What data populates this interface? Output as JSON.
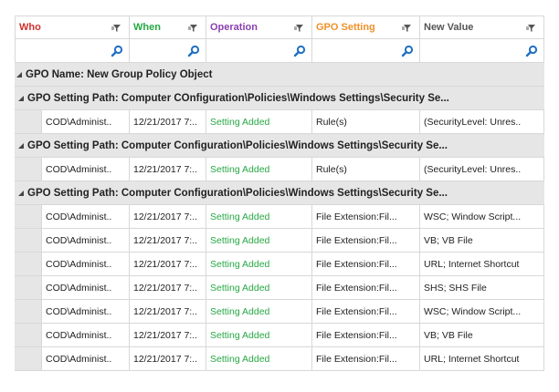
{
  "columns": [
    {
      "label": "Who",
      "color": "#d0312d"
    },
    {
      "label": "When",
      "color": "#27a844"
    },
    {
      "label": "Operation",
      "color": "#8a3fb0"
    },
    {
      "label": "GPO Setting",
      "color": "#f0912a"
    },
    {
      "label": "New Value",
      "color": "#555555"
    }
  ],
  "group": {
    "label": "GPO Name: New Group Policy Object"
  },
  "subgroups": [
    {
      "label": "GPO Setting Path: Computer COnfiguration\\Policies\\Windows Settings\\Security Se...",
      "rows": [
        {
          "who": "COD\\Administ..",
          "when": "12/21/2017 7:..",
          "operation": "Setting Added",
          "setting": "Rule(s)",
          "value": "(SecurityLevel: Unres.."
        }
      ]
    },
    {
      "label": "GPO Setting Path: Computer Configuration\\Policies\\Windows Settings\\Security Se...",
      "rows": [
        {
          "who": "COD\\Administ..",
          "when": "12/21/2017 7:..",
          "operation": "Setting Added",
          "setting": "Rule(s)",
          "value": "(SecurityLevel: Unres.."
        }
      ]
    },
    {
      "label": "GPO Setting Path: Computer Configuration\\Policies\\Windows Settings\\Security Se...",
      "rows": [
        {
          "who": "COD\\Administ..",
          "when": "12/21/2017 7:..",
          "operation": "Setting Added",
          "setting": "File Extension:Fil...",
          "value": "WSC; Window Script..."
        },
        {
          "who": "COD\\Administ..",
          "when": "12/21/2017 7:..",
          "operation": "Setting Added",
          "setting": "File Extension:Fil...",
          "value": "VB; VB File"
        },
        {
          "who": "COD\\Administ..",
          "when": "12/21/2017 7:..",
          "operation": "Setting Added",
          "setting": "File Extension:Fil...",
          "value": "URL; Internet Shortcut"
        },
        {
          "who": "COD\\Administ..",
          "when": "12/21/2017 7:..",
          "operation": "Setting Added",
          "setting": "File Extension:Fil...",
          "value": "SHS; SHS File"
        },
        {
          "who": "COD\\Administ..",
          "when": "12/21/2017 7:..",
          "operation": "Setting Added",
          "setting": "File Extension:Fil...",
          "value": "WSC; Window Script..."
        },
        {
          "who": "COD\\Administ..",
          "when": "12/21/2017 7:..",
          "operation": "Setting Added",
          "setting": "File Extension:Fil...",
          "value": "VB; VB File"
        },
        {
          "who": "COD\\Administ..",
          "when": "12/21/2017 7:..",
          "operation": "Setting Added",
          "setting": "File Extension:Fil...",
          "value": "URL; Internet Shortcut"
        }
      ]
    }
  ],
  "icons": {
    "filter": "filter-icon",
    "search": "search-icon",
    "expand": "collapse-triangle-icon"
  },
  "accent": "#1f6fc4"
}
